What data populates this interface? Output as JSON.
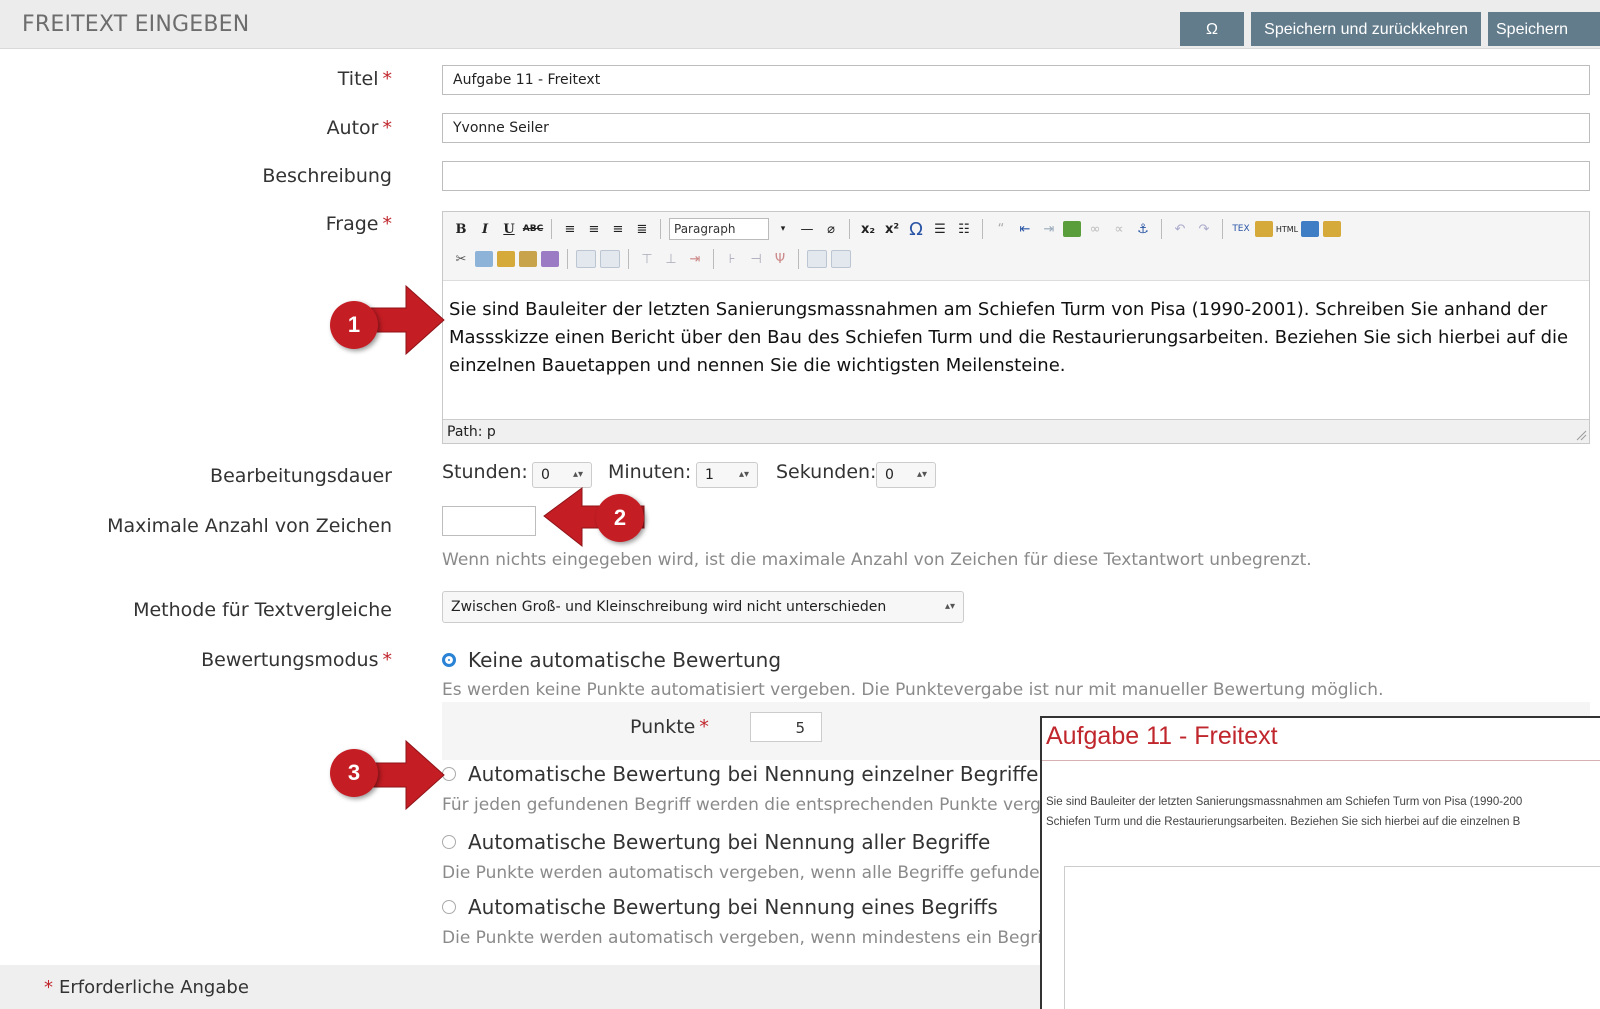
{
  "header": {
    "title": "FREITEXT EINGEBEN",
    "omega_label": "Ω",
    "save_return_label": "Speichern und zurückkehren",
    "save_label": "Speichern"
  },
  "form": {
    "required_mark": "*",
    "titel": {
      "label": "Titel",
      "value": "Aufgabe 11 - Freitext"
    },
    "autor": {
      "label": "Autor",
      "value": "Yvonne Seiler"
    },
    "beschreibung": {
      "label": "Beschreibung",
      "value": ""
    },
    "frage": {
      "label": "Frage",
      "format_select": "Paragraph",
      "paragraph_1": "Sie sind Bauleiter der letzten Sanierungsmassnahmen am Schiefen Turm von Pisa (1990-2001). Schreiben Sie anhand der",
      "paragraph_2": "Massskizze einen Bericht über den Bau des Schiefen Turm und die Restaurierungsarbeiten. Beziehen Sie sich hierbei auf die",
      "paragraph_3": "einzelnen Bauetappen und nennen Sie die wichtigsten Meilensteine.",
      "path": "Path: p"
    },
    "dauer": {
      "label": "Bearbeitungsdauer",
      "stunden_label": "Stunden:",
      "stunden_value": "0",
      "minuten_label": "Minuten:",
      "minuten_value": "1",
      "sekunden_label": "Sekunden:",
      "sekunden_value": "0"
    },
    "max_zeichen": {
      "label": "Maximale Anzahl von Zeichen",
      "value": "",
      "hint": "Wenn nichts eingegeben wird, ist die maximale Anzahl von Zeichen für diese Textantwort unbegrenzt."
    },
    "methode": {
      "label": "Methode für Textvergleiche",
      "value": "Zwischen Groß- und Kleinschreibung wird nicht unterschieden"
    },
    "bewertung": {
      "label": "Bewertungsmodus",
      "options": [
        {
          "label": "Keine automatische Bewertung",
          "selected": true,
          "hint": "Es werden keine Punkte automatisiert vergeben. Die Punktevergabe ist nur mit manueller Bewertung möglich."
        },
        {
          "label": "Automatische Bewertung bei Nennung einzelner Begriffe",
          "selected": false,
          "hint": "Für jeden gefundenen Begriff werden die entsprechenden Punkte verge"
        },
        {
          "label": "Automatische Bewertung bei Nennung aller Begriffe",
          "selected": false,
          "hint": "Die Punkte werden automatisch vergeben, wenn alle Begriffe gefunden"
        },
        {
          "label": "Automatische Bewertung bei Nennung eines Begriffs",
          "selected": false,
          "hint": "Die Punkte werden automatisch vergeben, wenn mindestens ein Begrif"
        }
      ],
      "punkte_label": "Punkte",
      "punkte_value": "5"
    },
    "footer_note": "Erforderliche Angabe"
  },
  "preview": {
    "title": "Aufgabe 11 - Freitext",
    "line_1": "Sie sind Bauleiter der letzten Sanierungsmassnahmen am Schiefen Turm von Pisa (1990-200",
    "line_2": "Schiefen Turm und die Restaurierungsarbeiten. Beziehen Sie sich hierbei auf die einzelnen B"
  },
  "callouts": [
    "1",
    "2",
    "3"
  ],
  "colors": {
    "accent_button": "#637c8c",
    "required": "#c0272d",
    "callout": "#c51d24",
    "radio_selected": "#2b83d6"
  }
}
